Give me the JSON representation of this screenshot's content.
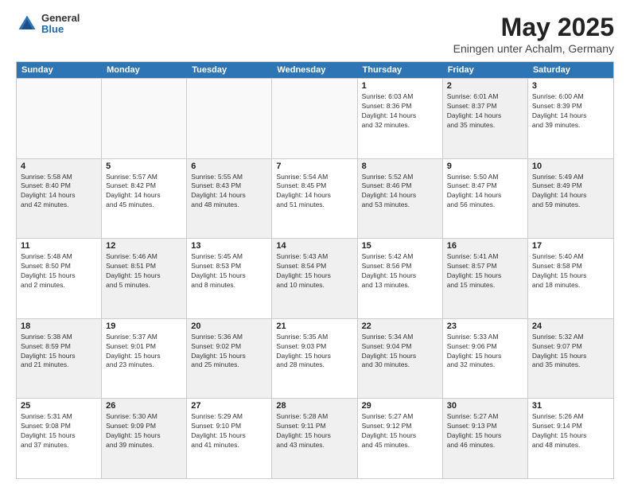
{
  "header": {
    "logo_general": "General",
    "logo_blue": "Blue",
    "month_title": "May 2025",
    "location": "Eningen unter Achalm, Germany"
  },
  "weekdays": [
    "Sunday",
    "Monday",
    "Tuesday",
    "Wednesday",
    "Thursday",
    "Friday",
    "Saturday"
  ],
  "rows": [
    [
      {
        "day": "",
        "info": "",
        "shaded": false,
        "empty": true
      },
      {
        "day": "",
        "info": "",
        "shaded": false,
        "empty": true
      },
      {
        "day": "",
        "info": "",
        "shaded": false,
        "empty": true
      },
      {
        "day": "",
        "info": "",
        "shaded": false,
        "empty": true
      },
      {
        "day": "1",
        "info": "Sunrise: 6:03 AM\nSunset: 8:36 PM\nDaylight: 14 hours\nand 32 minutes.",
        "shaded": false,
        "empty": false
      },
      {
        "day": "2",
        "info": "Sunrise: 6:01 AM\nSunset: 8:37 PM\nDaylight: 14 hours\nand 35 minutes.",
        "shaded": true,
        "empty": false
      },
      {
        "day": "3",
        "info": "Sunrise: 6:00 AM\nSunset: 8:39 PM\nDaylight: 14 hours\nand 39 minutes.",
        "shaded": false,
        "empty": false
      }
    ],
    [
      {
        "day": "4",
        "info": "Sunrise: 5:58 AM\nSunset: 8:40 PM\nDaylight: 14 hours\nand 42 minutes.",
        "shaded": true,
        "empty": false
      },
      {
        "day": "5",
        "info": "Sunrise: 5:57 AM\nSunset: 8:42 PM\nDaylight: 14 hours\nand 45 minutes.",
        "shaded": false,
        "empty": false
      },
      {
        "day": "6",
        "info": "Sunrise: 5:55 AM\nSunset: 8:43 PM\nDaylight: 14 hours\nand 48 minutes.",
        "shaded": true,
        "empty": false
      },
      {
        "day": "7",
        "info": "Sunrise: 5:54 AM\nSunset: 8:45 PM\nDaylight: 14 hours\nand 51 minutes.",
        "shaded": false,
        "empty": false
      },
      {
        "day": "8",
        "info": "Sunrise: 5:52 AM\nSunset: 8:46 PM\nDaylight: 14 hours\nand 53 minutes.",
        "shaded": true,
        "empty": false
      },
      {
        "day": "9",
        "info": "Sunrise: 5:50 AM\nSunset: 8:47 PM\nDaylight: 14 hours\nand 56 minutes.",
        "shaded": false,
        "empty": false
      },
      {
        "day": "10",
        "info": "Sunrise: 5:49 AM\nSunset: 8:49 PM\nDaylight: 14 hours\nand 59 minutes.",
        "shaded": true,
        "empty": false
      }
    ],
    [
      {
        "day": "11",
        "info": "Sunrise: 5:48 AM\nSunset: 8:50 PM\nDaylight: 15 hours\nand 2 minutes.",
        "shaded": false,
        "empty": false
      },
      {
        "day": "12",
        "info": "Sunrise: 5:46 AM\nSunset: 8:51 PM\nDaylight: 15 hours\nand 5 minutes.",
        "shaded": true,
        "empty": false
      },
      {
        "day": "13",
        "info": "Sunrise: 5:45 AM\nSunset: 8:53 PM\nDaylight: 15 hours\nand 8 minutes.",
        "shaded": false,
        "empty": false
      },
      {
        "day": "14",
        "info": "Sunrise: 5:43 AM\nSunset: 8:54 PM\nDaylight: 15 hours\nand 10 minutes.",
        "shaded": true,
        "empty": false
      },
      {
        "day": "15",
        "info": "Sunrise: 5:42 AM\nSunset: 8:56 PM\nDaylight: 15 hours\nand 13 minutes.",
        "shaded": false,
        "empty": false
      },
      {
        "day": "16",
        "info": "Sunrise: 5:41 AM\nSunset: 8:57 PM\nDaylight: 15 hours\nand 15 minutes.",
        "shaded": true,
        "empty": false
      },
      {
        "day": "17",
        "info": "Sunrise: 5:40 AM\nSunset: 8:58 PM\nDaylight: 15 hours\nand 18 minutes.",
        "shaded": false,
        "empty": false
      }
    ],
    [
      {
        "day": "18",
        "info": "Sunrise: 5:38 AM\nSunset: 8:59 PM\nDaylight: 15 hours\nand 21 minutes.",
        "shaded": true,
        "empty": false
      },
      {
        "day": "19",
        "info": "Sunrise: 5:37 AM\nSunset: 9:01 PM\nDaylight: 15 hours\nand 23 minutes.",
        "shaded": false,
        "empty": false
      },
      {
        "day": "20",
        "info": "Sunrise: 5:36 AM\nSunset: 9:02 PM\nDaylight: 15 hours\nand 25 minutes.",
        "shaded": true,
        "empty": false
      },
      {
        "day": "21",
        "info": "Sunrise: 5:35 AM\nSunset: 9:03 PM\nDaylight: 15 hours\nand 28 minutes.",
        "shaded": false,
        "empty": false
      },
      {
        "day": "22",
        "info": "Sunrise: 5:34 AM\nSunset: 9:04 PM\nDaylight: 15 hours\nand 30 minutes.",
        "shaded": true,
        "empty": false
      },
      {
        "day": "23",
        "info": "Sunrise: 5:33 AM\nSunset: 9:06 PM\nDaylight: 15 hours\nand 32 minutes.",
        "shaded": false,
        "empty": false
      },
      {
        "day": "24",
        "info": "Sunrise: 5:32 AM\nSunset: 9:07 PM\nDaylight: 15 hours\nand 35 minutes.",
        "shaded": true,
        "empty": false
      }
    ],
    [
      {
        "day": "25",
        "info": "Sunrise: 5:31 AM\nSunset: 9:08 PM\nDaylight: 15 hours\nand 37 minutes.",
        "shaded": false,
        "empty": false
      },
      {
        "day": "26",
        "info": "Sunrise: 5:30 AM\nSunset: 9:09 PM\nDaylight: 15 hours\nand 39 minutes.",
        "shaded": true,
        "empty": false
      },
      {
        "day": "27",
        "info": "Sunrise: 5:29 AM\nSunset: 9:10 PM\nDaylight: 15 hours\nand 41 minutes.",
        "shaded": false,
        "empty": false
      },
      {
        "day": "28",
        "info": "Sunrise: 5:28 AM\nSunset: 9:11 PM\nDaylight: 15 hours\nand 43 minutes.",
        "shaded": true,
        "empty": false
      },
      {
        "day": "29",
        "info": "Sunrise: 5:27 AM\nSunset: 9:12 PM\nDaylight: 15 hours\nand 45 minutes.",
        "shaded": false,
        "empty": false
      },
      {
        "day": "30",
        "info": "Sunrise: 5:27 AM\nSunset: 9:13 PM\nDaylight: 15 hours\nand 46 minutes.",
        "shaded": true,
        "empty": false
      },
      {
        "day": "31",
        "info": "Sunrise: 5:26 AM\nSunset: 9:14 PM\nDaylight: 15 hours\nand 48 minutes.",
        "shaded": false,
        "empty": false
      }
    ]
  ]
}
